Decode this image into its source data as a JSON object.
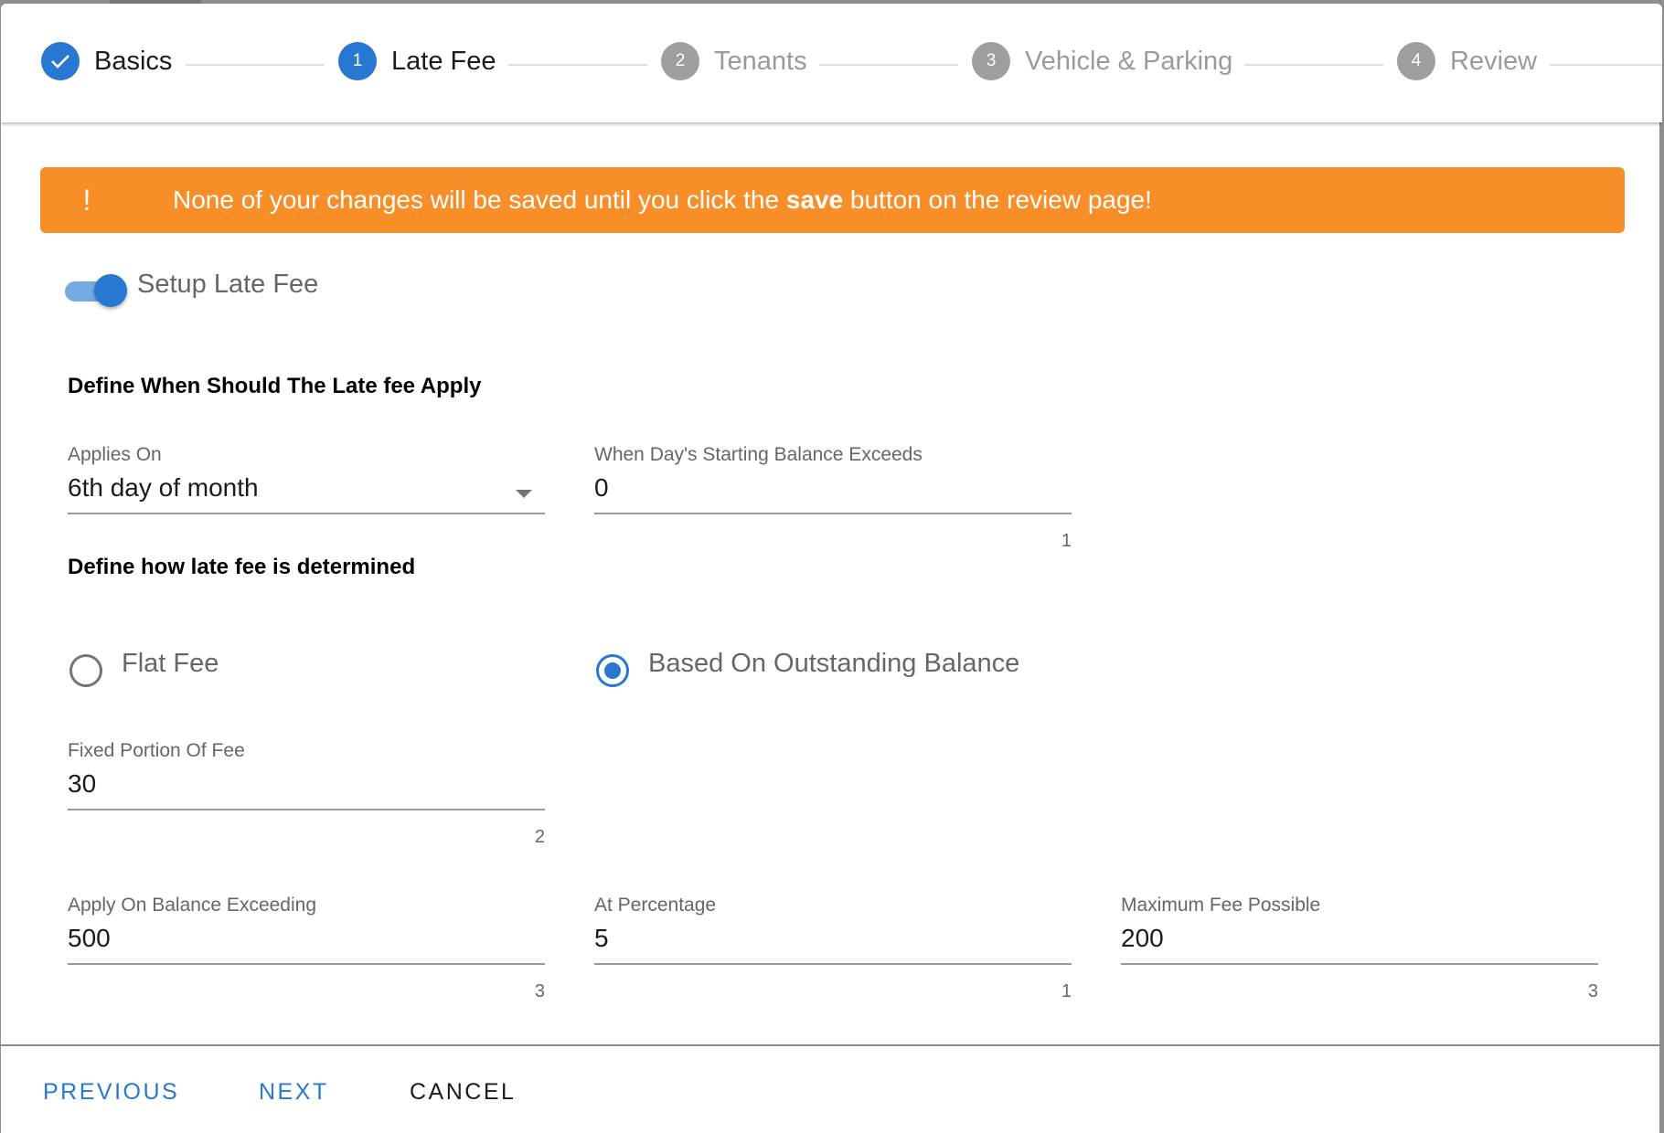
{
  "stepper": {
    "steps": [
      {
        "label": "Basics",
        "badge": "✓",
        "state": "done",
        "icon": "check-icon"
      },
      {
        "label": "Late Fee",
        "badge": "1",
        "state": "active"
      },
      {
        "label": "Tenants",
        "badge": "2",
        "state": "pending"
      },
      {
        "label": "Vehicle & Parking",
        "badge": "3",
        "state": "pending"
      },
      {
        "label": "Review",
        "badge": "4",
        "state": "pending"
      }
    ]
  },
  "banner": {
    "icon": "!",
    "text_before": "None of your changes will be saved until you click the ",
    "text_bold": "save",
    "text_after": " button on the review page!",
    "color": "#f88e28"
  },
  "toggle": {
    "label": "Setup Late Fee",
    "on": true
  },
  "section1": {
    "heading": "Define When Should The Late fee Apply",
    "applies_on": {
      "label": "Applies On",
      "value": "6th day of month"
    },
    "starting_balance": {
      "label": "When Day's Starting Balance Exceeds",
      "value": "0",
      "counter": "1"
    }
  },
  "section2": {
    "heading": "Define how late fee is determined",
    "radios": [
      {
        "label": "Flat Fee",
        "checked": false
      },
      {
        "label": "Based On Outstanding Balance",
        "checked": true
      }
    ],
    "fixed_portion": {
      "label": "Fixed Portion Of Fee",
      "value": "30",
      "counter": "2"
    },
    "apply_on_balance": {
      "label": "Apply On Balance Exceeding",
      "value": "500",
      "counter": "3"
    },
    "at_percentage": {
      "label": "At Percentage",
      "value": "5",
      "counter": "1"
    },
    "max_fee": {
      "label": "Maximum Fee Possible",
      "value": "200",
      "counter": "3"
    }
  },
  "footer": {
    "previous": "PREVIOUS",
    "next": "NEXT",
    "cancel": "CANCEL"
  },
  "colors": {
    "accent": "#2878d2",
    "warning": "#f88e28",
    "pending": "#9e9e9e"
  }
}
